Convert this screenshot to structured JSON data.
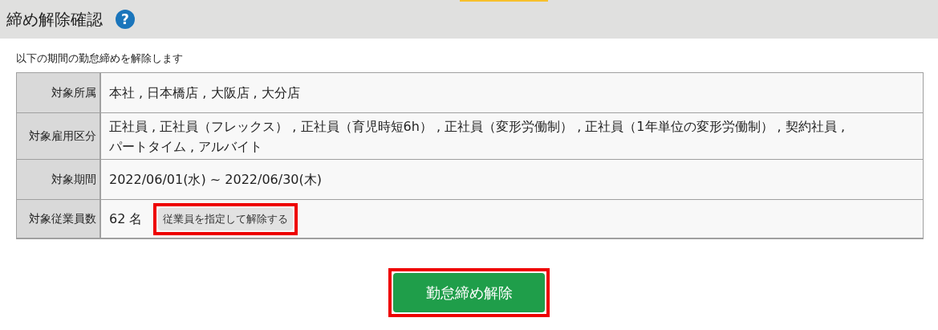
{
  "header": {
    "title": "締め解除確認",
    "help_icon": "?"
  },
  "description": "以下の期間の勤怠締めを解除します",
  "rows": [
    {
      "kind": "text",
      "label": "対象所属",
      "lines": [
        "本社 , 日本橋店 , 大阪店 , 大分店"
      ]
    },
    {
      "kind": "text",
      "label": "対象雇用区分",
      "lines": [
        "正社員 , 正社員（フレックス） , 正社員（育児時短6h） , 正社員（変形労働制） , 正社員（1年単位の変形労働制） , 契約社員 ,",
        "パートタイム , アルバイト"
      ]
    },
    {
      "kind": "text",
      "label": "対象期間",
      "lines": [
        "2022/06/01(水) ~ 2022/06/30(木)"
      ]
    },
    {
      "kind": "count",
      "label": "対象従業員数",
      "value": "62 名",
      "button": {
        "label": "従業員を指定して解除する",
        "highlighted": true
      }
    }
  ],
  "submit": {
    "label": "勤怠締め解除",
    "highlighted": true
  }
}
